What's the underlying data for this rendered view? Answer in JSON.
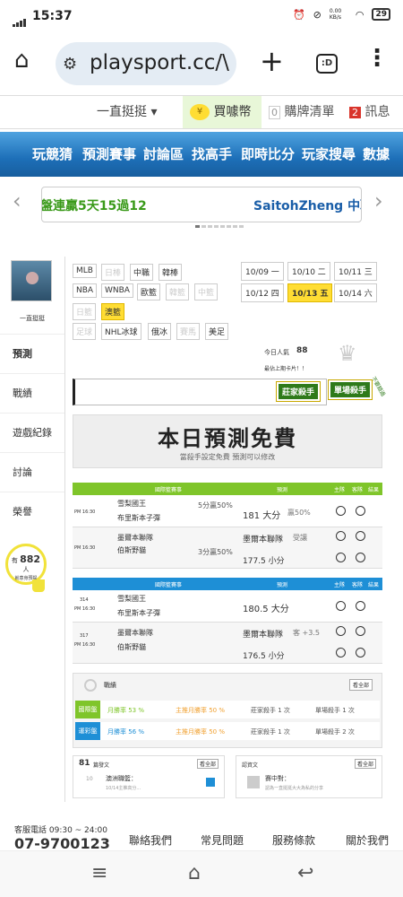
{
  "status_bar": {
    "time": "15:37",
    "net_speed": "0.00 KB/s",
    "battery": "29"
  },
  "browser": {
    "url": "playsport.cc/\\",
    "tabs_label": ":D"
  },
  "top_nav": {
    "user_menu": "一直挺挺 ▾",
    "coins": "買噱幣",
    "list_count": "0",
    "list_label": "購牌清單",
    "msg_count": "2",
    "msg_label": "訊息"
  },
  "main_nav": [
    "玩競猜",
    "預測賽事",
    "討論區",
    "找高手",
    "即時比分",
    "玩家搜尋",
    "數據"
  ],
  "ticker": {
    "left_text": "盤連贏5天15過12",
    "right_text": "SaitohZheng 中職"
  },
  "sidebar": {
    "username": "一直挺挺",
    "items": [
      "預測",
      "戰績",
      "遊戲紀錄",
      "討論",
      "榮譽"
    ],
    "online_prefix": "有",
    "online_count": "882",
    "online_suffix": "人",
    "online_note": "就意身預提"
  },
  "leagues": {
    "row1": [
      "MLB",
      "日棒",
      "中職",
      "韓棒"
    ],
    "row2": [
      "NBA",
      "WNBA",
      "歐籃",
      "韓籃",
      "中籃"
    ],
    "row3": [
      "日籃",
      "澳籃"
    ],
    "row4": [
      "足球",
      "NHL冰球",
      "俄冰",
      "賽馬",
      "美足"
    ]
  },
  "dates": [
    {
      "label": "10/09 一",
      "hl": false
    },
    {
      "label": "10/10 二",
      "hl": false
    },
    {
      "label": "10/11 三",
      "hl": false
    },
    {
      "label": "10/12 四",
      "hl": false
    },
    {
      "label": "10/13 五",
      "hl": true
    },
    {
      "label": "10/14 六",
      "hl": false
    }
  ],
  "info": {
    "today_label": "今日人氣",
    "today_count": "88",
    "recent": "最佔上期卡片！！"
  },
  "badges": {
    "b1": "莊家殺手",
    "b2": "單場殺手",
    "b3": "不要錯過"
  },
  "banner": {
    "title": "本日預測免費",
    "subtitle": "當殺手設定免費 預測可以修改"
  },
  "table_headers": {
    "league": "國際籃賽事",
    "predict": "預測",
    "host": "主隊",
    "guest": "客隊",
    "result": "結果"
  },
  "game_block_1": [
    {
      "time": "PM 16:30",
      "team1": "雪梨國王",
      "team2": "布里斯本子彈",
      "line": "5分贏50%",
      "pred": "181 大分",
      "pred_note": "贏50%"
    },
    {
      "time": "PM 16:30",
      "team1": "墨爾本聯隊",
      "team2": "伯斯野貓",
      "line": "3分贏50%",
      "pred": "墨爾本聯隊",
      "pred_note": "受讓",
      "pred2": "177.5 小分"
    }
  ],
  "game_block_2": [
    {
      "no": "314",
      "time": "PM 16:30",
      "team1": "雪梨國王",
      "team2": "布里斯本子彈",
      "pred": "180.5 大分"
    },
    {
      "no": "317",
      "time": "PM 16:30",
      "team1": "墨爾本聯隊",
      "team2": "伯斯野貓",
      "pred": "墨爾本聯隊",
      "pred_note": "客 +3.5",
      "pred2": "176.5 小分"
    }
  ],
  "stats": {
    "title": "戰績",
    "more": "看全部",
    "row1": {
      "label": "國際盤",
      "a": "月勝率 53 %",
      "b": "主推月勝率 50 %",
      "c": "莊家殺手 1 次",
      "d": "單場殺手 1 次"
    },
    "row2": {
      "label": "運彩盤",
      "a": "月勝率 56 %",
      "b": "主推月勝率 50 %",
      "c": "莊家殺手 1 次",
      "d": "單場殺手 2 次"
    }
  },
  "bottom": {
    "count": "81",
    "count_label": "篇發文",
    "more1": "看全部",
    "post_no": "10",
    "post_title": "澳洲職籃：",
    "post_sub": "10/14主推高分...",
    "title2": "認資文",
    "more2": "看全部",
    "post2_title": "賽中對：",
    "post2_sub": "認為一直挺挺大大為私的分享"
  },
  "footer": {
    "phone_label": "客服電話 09:30 ~ 24:00",
    "phone": "07-9700123",
    "links": [
      "聯絡我們",
      "常見問題",
      "服務條款",
      "關於我們"
    ]
  },
  "colors": {
    "green": "#7fc52a",
    "blue": "#1e8fd6",
    "yellow": "#ffdd33",
    "nav_blue": "#1d6fb8"
  }
}
